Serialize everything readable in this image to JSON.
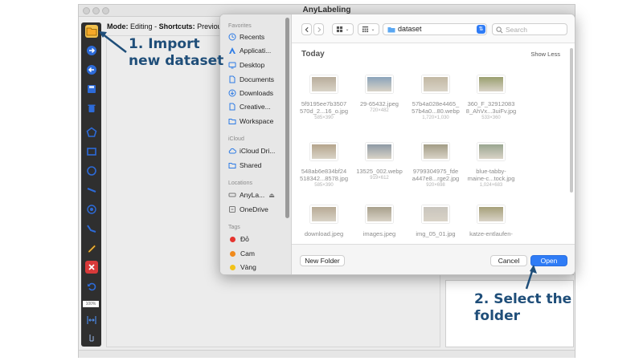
{
  "app": {
    "title": "AnyLabeling",
    "mode_label": "Mode:",
    "mode_value": "Editing",
    "shortcuts_label": "Shortcuts:",
    "shortcuts_value": "Previous:",
    "zoom": "100%"
  },
  "toolbar": {
    "tools": [
      "open-folder-icon",
      "next-image-icon",
      "previous-image-icon",
      "save-icon",
      "delete-file-icon",
      "polygon-icon",
      "rectangle-icon",
      "circle-icon",
      "line-icon",
      "point-icon",
      "linestrip-icon",
      "edit-icon",
      "delete-shape-icon",
      "undo-icon",
      "fit-width-icon",
      "brightness-icon"
    ]
  },
  "dialog": {
    "sidebar": {
      "favorites_header": "Favorites",
      "favorites": [
        "Recents",
        "Applicati...",
        "Desktop",
        "Documents",
        "Downloads",
        "Creative...",
        "Workspace"
      ],
      "icloud_header": "iCloud",
      "icloud": [
        "iCloud Dri...",
        "Shared"
      ],
      "locations_header": "Locations",
      "locations": [
        "AnyLa...",
        "OneDrive"
      ],
      "tags_header": "Tags",
      "tags": [
        {
          "label": "Đỏ",
          "color": "#e5342f"
        },
        {
          "label": "Cam",
          "color": "#f08a1c"
        },
        {
          "label": "Vàng",
          "color": "#f2c218"
        }
      ]
    },
    "path": "dataset",
    "search_placeholder": "Search",
    "section_title": "Today",
    "show_less": "Show Less",
    "files": [
      {
        "name1": "5f9195ee7b3507",
        "name2": "570d_2...16_o.jpg",
        "size": "585×390",
        "color": "#b8ad9b"
      },
      {
        "name1": "29-65432.jpeg",
        "name2": "",
        "size": "720×482",
        "color": "#8aa3ba"
      },
      {
        "name1": "57b4a028e4465_",
        "name2": "57b4a0...80.webp",
        "size": "1,720×1,030",
        "color": "#c2b8a3"
      },
      {
        "name1": "360_F_32912083",
        "name2": "8_AhVx...3uiFv.jpg",
        "size": "533×360",
        "color": "#9a9f6f"
      },
      {
        "name1": "548ab6e834bf24",
        "name2": "518342...8578.jpg",
        "size": "585×390",
        "color": "#b5a58c"
      },
      {
        "name1": "13525_002.webp",
        "name2": "",
        "size": "919×612",
        "color": "#8e9aa5"
      },
      {
        "name1": "9799304975_fde",
        "name2": "a447e8...rge2.jpg",
        "size": "920×698",
        "color": "#a39d86"
      },
      {
        "name1": "blue-tabby-",
        "name2": "maine-c...tock.jpg",
        "size": "1,024×683",
        "color": "#9aa690"
      },
      {
        "name1": "download.jpeg",
        "name2": "",
        "size": "",
        "color": "#b7aa95"
      },
      {
        "name1": "images.jpeg",
        "name2": "",
        "size": "",
        "color": "#a8a08c"
      },
      {
        "name1": "img_05_01.jpg",
        "name2": "",
        "size": "",
        "color": "#c9c5bd"
      },
      {
        "name1": "katze-entlaufen-",
        "name2": "",
        "size": "",
        "color": "#a6a079"
      }
    ],
    "new_folder": "New Folder",
    "cancel": "Cancel",
    "open": "Open"
  },
  "annotations": {
    "step1_line1": "1. Import",
    "step1_line2": "new dataset",
    "step2_line1": "2. Select the",
    "step2_line2": "folder",
    "color": "#1f4e79"
  }
}
